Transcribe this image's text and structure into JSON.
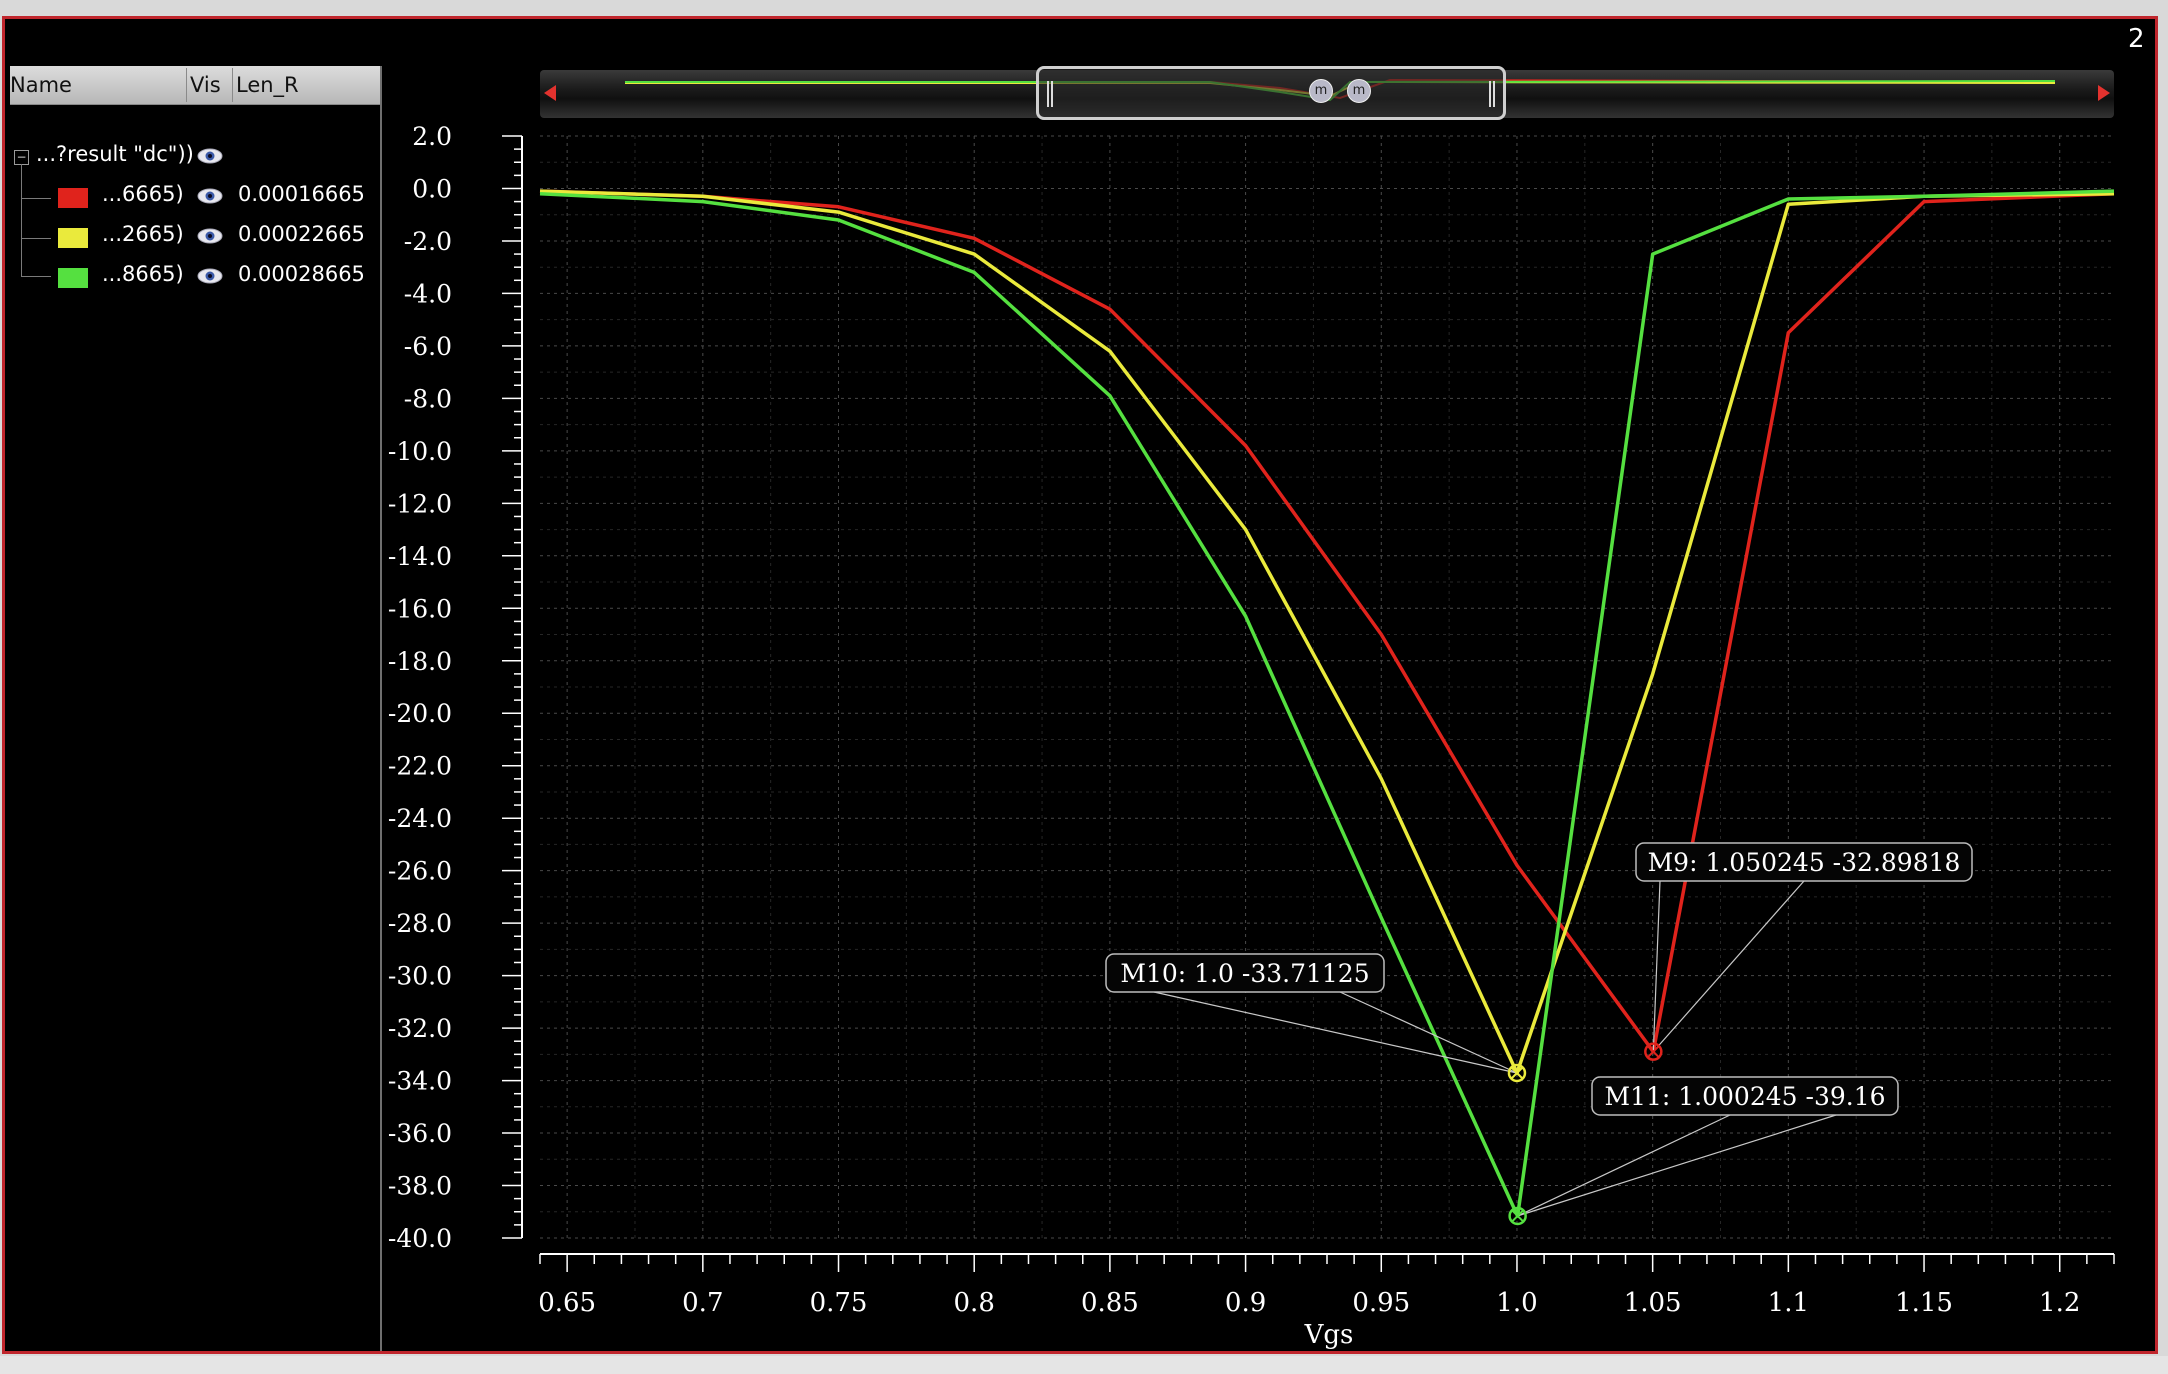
{
  "window": {
    "page_number": "2"
  },
  "legend_panel": {
    "columns": [
      "Name",
      "Vis",
      "Len_R"
    ],
    "root_label": "...?result \"dc\"))",
    "rows": [
      {
        "name": "...6665)",
        "color": "#e0231c",
        "value": "0.00016665"
      },
      {
        "name": "...2665)",
        "color": "#eaea3c",
        "value": "0.00022665"
      },
      {
        "name": "...8665)",
        "color": "#55e040",
        "value": "0.00028665"
      }
    ]
  },
  "navigator": {
    "marker_label": "m"
  },
  "chart_data": {
    "type": "line",
    "xlabel": "Vgs",
    "ylabel": "",
    "xlim": [
      0.64,
      1.22
    ],
    "ylim": [
      -40.0,
      2.0
    ],
    "x_ticks": [
      "0.65",
      "0.7",
      "0.75",
      "0.8",
      "0.85",
      "0.9",
      "0.95",
      "1.0",
      "1.05",
      "1.1",
      "1.15",
      "1.2"
    ],
    "y_ticks": [
      "2.0",
      "0.0",
      "-2.0",
      "-4.0",
      "-6.0",
      "-8.0",
      "-10.0",
      "-12.0",
      "-14.0",
      "-16.0",
      "-18.0",
      "-20.0",
      "-22.0",
      "-24.0",
      "-26.0",
      "-28.0",
      "-30.0",
      "-32.0",
      "-34.0",
      "-36.0",
      "-38.0",
      "-40.0"
    ],
    "grid": true,
    "series": [
      {
        "name": "...6665)",
        "color": "#e0231c",
        "x": [
          0.64,
          0.7,
          0.75,
          0.8,
          0.85,
          0.9,
          0.95,
          1.0,
          1.050245,
          1.1,
          1.15,
          1.22
        ],
        "y": [
          -0.1,
          -0.3,
          -0.7,
          -1.9,
          -4.6,
          -9.8,
          -17.0,
          -25.8,
          -32.89818,
          -5.5,
          -0.5,
          -0.2
        ]
      },
      {
        "name": "...2665)",
        "color": "#eaea3c",
        "x": [
          0.64,
          0.7,
          0.75,
          0.8,
          0.85,
          0.9,
          0.95,
          1.0,
          1.05,
          1.1,
          1.15,
          1.22
        ],
        "y": [
          -0.1,
          -0.3,
          -0.9,
          -2.5,
          -6.2,
          -13.0,
          -22.5,
          -33.71125,
          -18.5,
          -0.6,
          -0.3,
          -0.2
        ]
      },
      {
        "name": "...8665)",
        "color": "#55e040",
        "x": [
          0.64,
          0.7,
          0.75,
          0.8,
          0.85,
          0.9,
          0.95,
          1.000245,
          1.05,
          1.1,
          1.15,
          1.22
        ],
        "y": [
          -0.2,
          -0.5,
          -1.2,
          -3.2,
          -7.9,
          -16.3,
          -27.8,
          -39.16,
          -2.5,
          -0.4,
          -0.3,
          -0.1
        ]
      }
    ],
    "markers": [
      {
        "label": "M9: 1.050245 -32.89818",
        "x": 1.050245,
        "y": -32.89818,
        "color": "#e0231c"
      },
      {
        "label": "M10: 1.0 -33.71125",
        "x": 1.0,
        "y": -33.71125,
        "color": "#eaea3c"
      },
      {
        "label": "M11: 1.000245 -39.16",
        "x": 1.000245,
        "y": -39.16,
        "color": "#55e040"
      }
    ]
  }
}
